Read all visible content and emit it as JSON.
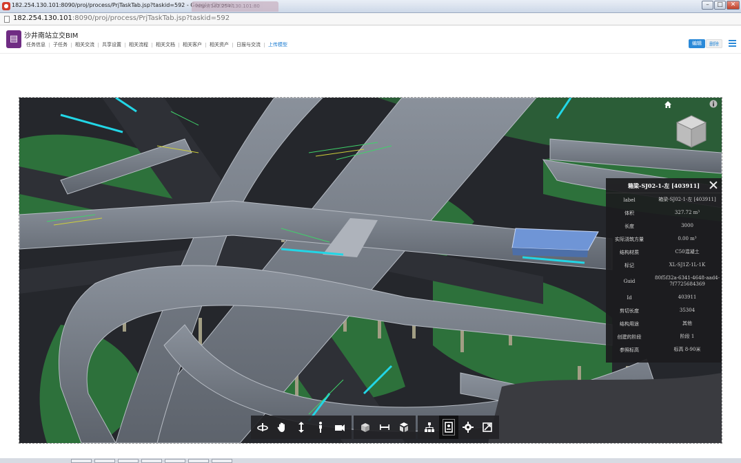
{
  "window": {
    "title": "182.254.130.101:8090/proj/process/PrjTaskTab.jsp?taskid=592 - Google Chrome",
    "inactive_tab_label": "http://182.254.130.101:80"
  },
  "address": {
    "host": "182.254.130.101",
    "path": ":8090/proj/process/PrjTaskTab.jsp?taskid=592"
  },
  "header": {
    "title": "沙井南站立交BIM",
    "tabs": [
      "任务信息",
      "子任务",
      "相关交流",
      "共享设置",
      "相关流程",
      "相关文档",
      "相关客户",
      "相关资产",
      "日报与交流",
      "上传模型"
    ],
    "active_tab": "上传模型",
    "edit_label": "编辑",
    "delete_label": "删除"
  },
  "properties": {
    "title": "箱梁-SJ02-1-左 [403911]",
    "rows": [
      {
        "key": "label",
        "value": "箱梁-SJ02-1-左 [403911]"
      },
      {
        "key": "体积",
        "value": "327.72 m³"
      },
      {
        "key": "长度",
        "value": "3000"
      },
      {
        "key": "实际浇筑方量",
        "value": "0.00 m³"
      },
      {
        "key": "结构材质",
        "value": "C50混凝土"
      },
      {
        "key": "标记",
        "value": "XL-SJ1Z-1L-1K"
      },
      {
        "key": "Guid",
        "value": "80f5f32a-6341-4648-aad4-7f7725684369"
      },
      {
        "key": "Id",
        "value": "403911"
      },
      {
        "key": "剪切长度",
        "value": "35304"
      },
      {
        "key": "结构用途",
        "value": "其他"
      },
      {
        "key": "创建的阶段",
        "value": "阶段 1"
      },
      {
        "key": "参照标高",
        "value": "标高 8-90米"
      }
    ]
  },
  "toolbar": {
    "groups": [
      [
        "orbit-icon",
        "pan-icon",
        "dolly-icon",
        "walk-icon",
        "camera-icon"
      ],
      [
        "section-box-icon",
        "measure-icon",
        "explode-icon"
      ],
      [
        "model-tree-icon",
        "properties-icon",
        "settings-icon",
        "fullscreen-icon"
      ]
    ],
    "active": "properties-icon"
  },
  "colors": {
    "accent": "#2a89d8",
    "project_icon": "#6f2c83",
    "terrain": "#2f7a3e",
    "bridge_deck": "#767d88",
    "selected_element": "#6f95d6"
  }
}
